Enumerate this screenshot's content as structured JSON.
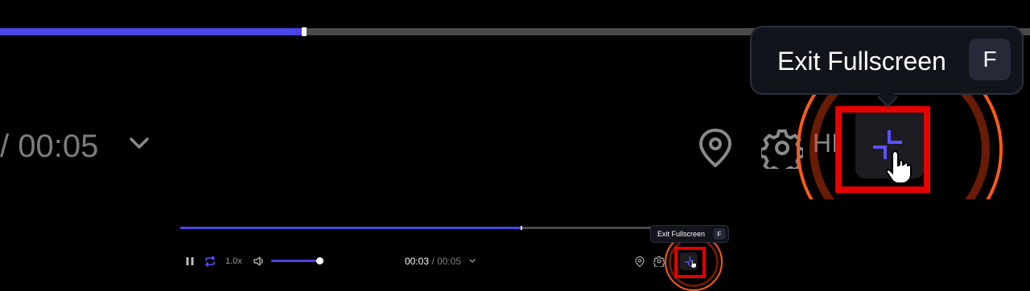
{
  "zoom_view": {
    "current_time_partial": "/ 00:05",
    "quality_partial": "HI",
    "tooltip": {
      "label": "Exit Fullscreen",
      "shortcut": "F"
    },
    "progress": 0.293
  },
  "player": {
    "progress": 0.705,
    "playback_speed": "1.0x",
    "volume": 0.98,
    "time": {
      "current": "00:03",
      "separator": "/",
      "duration": "00:05"
    },
    "quality_partial": "H",
    "tooltip": {
      "label": "Exit Fullscreen",
      "shortcut": "F"
    },
    "icons": [
      "pause-icon",
      "loop-icon",
      "volume-icon",
      "chevron-down-icon",
      "location-pin-icon",
      "gear-icon",
      "exit-fullscreen-icon",
      "hand-cursor-icon"
    ]
  },
  "colors": {
    "accent": "#4b45e6",
    "track": "#4a4a4a",
    "highlight_box": "#e50000",
    "highlight_ring": "#ff5a1c",
    "tooltip_bg": "#12141c"
  }
}
